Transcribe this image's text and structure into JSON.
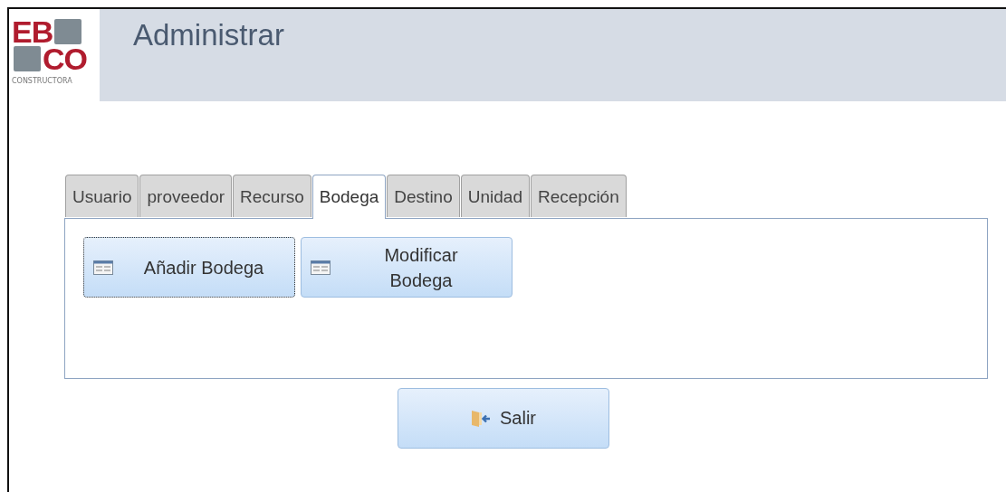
{
  "logo": {
    "line_1": "EB",
    "line_2": "CO",
    "tagline": "CONSTRUCTORA"
  },
  "header": {
    "title": "Administrar"
  },
  "tabs": [
    {
      "label": "Usuario",
      "selected": false
    },
    {
      "label": "proveedor",
      "selected": false
    },
    {
      "label": "Recurso",
      "selected": false
    },
    {
      "label": "Bodega",
      "selected": true
    },
    {
      "label": "Destino",
      "selected": false
    },
    {
      "label": "Unidad",
      "selected": false
    },
    {
      "label": "Recepción",
      "selected": false
    }
  ],
  "panel_buttons": [
    {
      "label": "Añadir Bodega",
      "focused": true
    },
    {
      "label": "Modificar Bodega",
      "focused": false
    }
  ],
  "exit_button": {
    "label": "Salir"
  }
}
